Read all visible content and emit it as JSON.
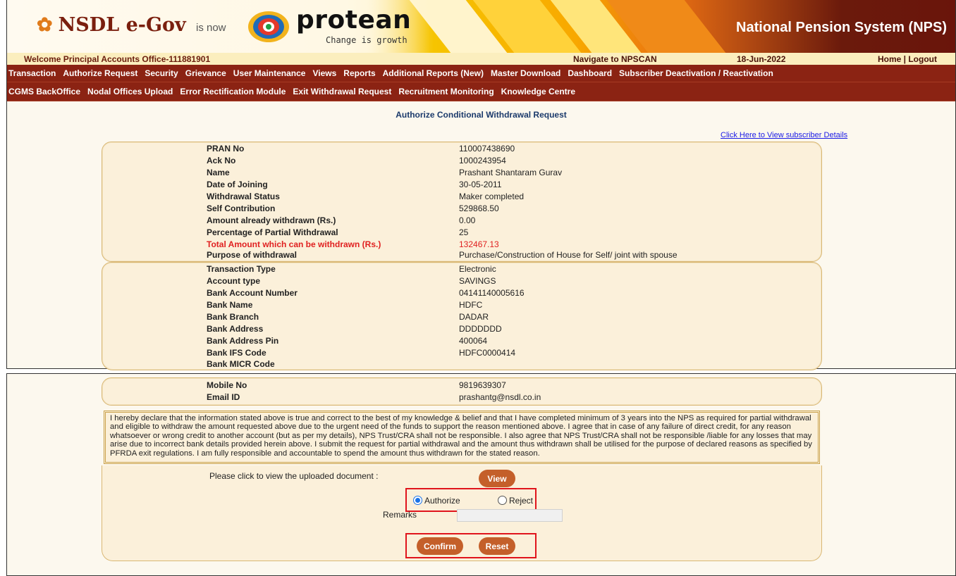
{
  "header": {
    "nsdl_logo": "NSDL e-Gov",
    "is_now": "is now",
    "protean_name": "protean",
    "protean_tagline": "Change is growth",
    "nps_title": "National Pension System (NPS)"
  },
  "welcome_bar": {
    "welcome_text": "Welcome Principal Accounts Office-111881901",
    "navigate": "Navigate to NPSCAN",
    "date": "18-Jun-2022",
    "links": "Home | Logout"
  },
  "menu_primary": [
    "Transaction",
    "Authorize Request",
    "Security",
    "Grievance",
    "User Maintenance",
    "Views",
    "Reports",
    "Additional Reports (New)",
    "Master Download",
    "Dashboard",
    "Subscriber Deactivation / Reactivation"
  ],
  "menu_secondary": [
    "CGMS BackOffice",
    "Nodal Offices Upload",
    "Error Rectification Module",
    "Exit Withdrawal Request",
    "Recruitment Monitoring",
    "Knowledge Centre"
  ],
  "page_title": "Authorize Conditional Withdrawal Request",
  "subscriber_link": "Click Here to View subscriber Details",
  "withdrawal_details": [
    {
      "label": "PRAN No",
      "value": "110007438690"
    },
    {
      "label": "Ack No",
      "value": "1000243954"
    },
    {
      "label": "Name",
      "value": "Prashant Shantaram Gurav"
    },
    {
      "label": "Date of Joining",
      "value": "30-05-2011"
    },
    {
      "label": "Withdrawal Status",
      "value": "Maker completed"
    },
    {
      "label": "Self Contribution",
      "value": "529868.50"
    },
    {
      "label": "Amount already withdrawn (Rs.)",
      "value": "0.00"
    },
    {
      "label": "Percentage of Partial Withdrawal",
      "value": "25"
    },
    {
      "label": "Total Amount which can be withdrawn (Rs.)",
      "value": "132467.13"
    },
    {
      "label": "Purpose of withdrawal",
      "value": "Purchase/Construction of House for Self/ joint with spouse"
    }
  ],
  "bank_details": [
    {
      "label": "Transaction Type",
      "value": "Electronic"
    },
    {
      "label": "Account type",
      "value": "SAVINGS"
    },
    {
      "label": "Bank Account Number",
      "value": "04141140005616"
    },
    {
      "label": "Bank Name",
      "value": "HDFC"
    },
    {
      "label": "Bank Branch",
      "value": "DADAR"
    },
    {
      "label": "Bank Address",
      "value": "DDDDDDD"
    },
    {
      "label": "Bank Address Pin",
      "value": "400064"
    },
    {
      "label": "Bank IFS Code",
      "value": "HDFC0000414"
    },
    {
      "label": "Bank MICR Code",
      "value": ""
    }
  ],
  "contact_details": [
    {
      "label": "Mobile No",
      "value": "9819639307"
    },
    {
      "label": "Email ID",
      "value": "prashantg@nsdl.co.in"
    }
  ],
  "declaration": "I hereby declare that the information stated above is true and correct to the best of my knowledge & belief and that I have completed minimum of 3 years into the NPS as required for partial withdrawal and eligible to withdraw the amount requested above due to the urgent need of the funds to support the reason mentioned above. I agree that in case of any failure of direct credit, for any reason whatsoever or wrong credit to another account (but as per my details), NPS Trust/CRA shall not be responsible. I also agree that NPS Trust/CRA shall not be responsible /liable for any losses that may arise due to incorrect bank details provided herein above. I submit the request for partial withdrawal and the amount thus withdrawn shall be utilised for the purpose of declared reasons as specified by PFRDA exit regulations. I am fully responsible and accountable to spend the amount thus withdrawn for the stated reason.",
  "document": {
    "label": "Please click to view the uploaded document :",
    "view_button": "View"
  },
  "decision": {
    "authorize_label": "Authorize",
    "reject_label": "Reject",
    "selected": "Authorize"
  },
  "remarks": {
    "label": "Remarks",
    "value": ""
  },
  "actions": {
    "confirm": "Confirm",
    "reset": "Reset"
  },
  "colors": {
    "menu_bg": "#8b2313",
    "button": "#c45f2a",
    "highlight_box": "#e0141c",
    "warning_text": "#e02020"
  }
}
